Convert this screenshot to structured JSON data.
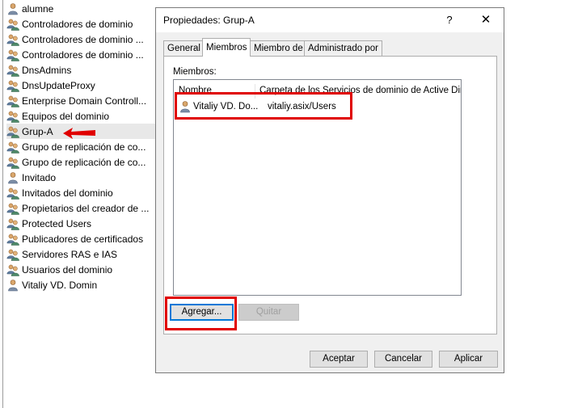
{
  "tree": {
    "items": [
      {
        "label": "alumne",
        "icon": "user-icon"
      },
      {
        "label": "Controladores de dominio",
        "icon": "group-icon"
      },
      {
        "label": "Controladores de dominio ...",
        "icon": "group-icon"
      },
      {
        "label": "Controladores de dominio ...",
        "icon": "group-icon"
      },
      {
        "label": "DnsAdmins",
        "icon": "group-icon"
      },
      {
        "label": "DnsUpdateProxy",
        "icon": "group-icon"
      },
      {
        "label": "Enterprise Domain Controll...",
        "icon": "group-icon"
      },
      {
        "label": "Equipos del dominio",
        "icon": "group-icon"
      },
      {
        "label": "Grup-A",
        "icon": "group-icon"
      },
      {
        "label": "Grupo de replicación de co...",
        "icon": "group-icon"
      },
      {
        "label": "Grupo de replicación de co...",
        "icon": "group-icon"
      },
      {
        "label": "Invitado",
        "icon": "user-icon"
      },
      {
        "label": "Invitados del dominio",
        "icon": "group-icon"
      },
      {
        "label": "Propietarios del creador de ...",
        "icon": "group-icon"
      },
      {
        "label": "Protected Users",
        "icon": "group-icon"
      },
      {
        "label": "Publicadores de certificados",
        "icon": "group-icon"
      },
      {
        "label": "Servidores RAS e IAS",
        "icon": "group-icon"
      },
      {
        "label": "Usuarios del dominio",
        "icon": "group-icon"
      },
      {
        "label": "Vitaliy VD. Domin",
        "icon": "user-icon"
      }
    ],
    "selected_index": 8
  },
  "dialog": {
    "title": "Propiedades: Grup-A",
    "help": "?",
    "close": "✕",
    "tabs": [
      "General",
      "Miembros",
      "Miembro de",
      "Administrado por"
    ],
    "active_tab": 1,
    "members_label": "Miembros:",
    "columns": [
      "Nombre",
      "Carpeta de los Servicios de dominio de Active Dir..."
    ],
    "members": [
      {
        "name": "Vitaliy VD. Do...",
        "folder": "vitaliy.asix/Users"
      }
    ],
    "add_button": "Agregar...",
    "remove_button": "Quitar",
    "accept_button": "Aceptar",
    "cancel_button": "Cancelar",
    "apply_button": "Aplicar"
  },
  "colors": {
    "highlight": "#e00000",
    "selection": "#e8e8e8",
    "focus_border": "#0078d7"
  }
}
